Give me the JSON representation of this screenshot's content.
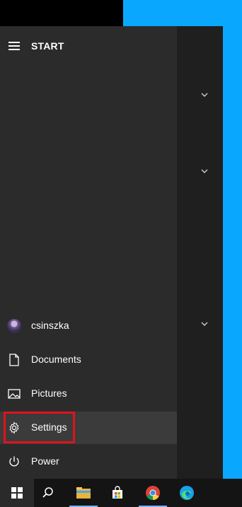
{
  "start_menu": {
    "title": "START",
    "items": [
      {
        "label": "csinszka",
        "icon": "avatar"
      },
      {
        "label": "Documents",
        "icon": "document-icon"
      },
      {
        "label": "Pictures",
        "icon": "pictures-icon"
      },
      {
        "label": "Settings",
        "icon": "gear-icon"
      },
      {
        "label": "Power",
        "icon": "power-icon"
      }
    ]
  },
  "tile_groups": [
    {
      "icon": "chevron-down-icon"
    },
    {
      "icon": "chevron-down-icon"
    },
    {
      "icon": "chevron-down-icon"
    }
  ],
  "taskbar": {
    "items": [
      "windows-start-icon",
      "search-icon",
      "file-explorer-icon",
      "microsoft-store-icon",
      "chrome-icon",
      "edge-icon"
    ]
  },
  "colors": {
    "desktop_blue": "#0aa7ff",
    "menu_bg": "#2b2b2b",
    "highlight_red": "#e0131b"
  }
}
